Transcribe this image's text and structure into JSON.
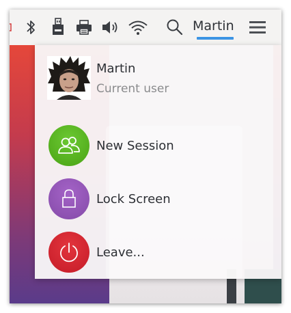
{
  "panel": {
    "user_name": "Martin",
    "icons": [
      "bluetooth-icon",
      "usb-drive-icon",
      "printer-icon",
      "volume-icon",
      "wifi-icon",
      "search-icon",
      "hamburger-menu-icon"
    ]
  },
  "user_menu": {
    "user": {
      "name": "Martin",
      "subtitle": "Current user"
    },
    "actions": [
      {
        "label": "New Session",
        "icon": "users-icon",
        "color": "#53b31a"
      },
      {
        "label": "Lock Screen",
        "icon": "lock-icon",
        "color": "#8d4db3"
      },
      {
        "label": "Leave...",
        "icon": "power-icon",
        "color": "#d0202f"
      }
    ]
  },
  "colors": {
    "accent_underline": "#3c94e4",
    "panel_bg": "#f4f3f2"
  }
}
